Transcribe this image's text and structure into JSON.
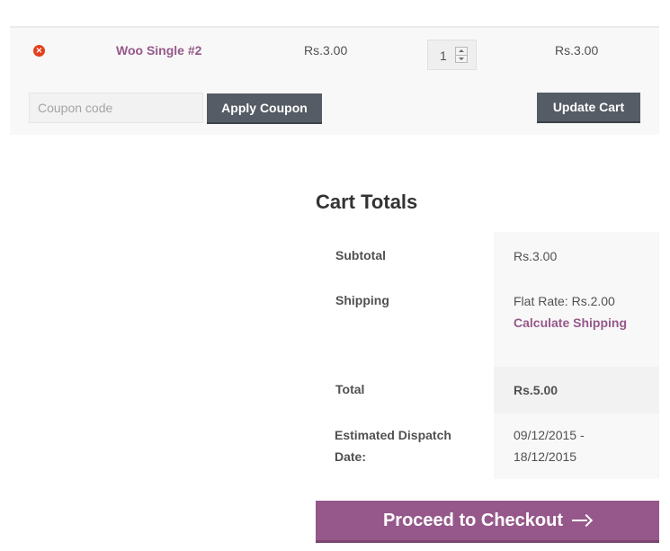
{
  "cart": {
    "items": [
      {
        "remove_symbol": "×",
        "product_name": "Woo Single #2",
        "price": "Rs.3.00",
        "quantity": "1",
        "subtotal": "Rs.3.00"
      }
    ],
    "coupon": {
      "placeholder": "Coupon code",
      "value": "",
      "apply_label": "Apply Coupon"
    },
    "update_label": "Update Cart"
  },
  "totals": {
    "title": "Cart Totals",
    "subtotal_label": "Subtotal",
    "subtotal_value": "Rs.3.00",
    "shipping_label": "Shipping",
    "shipping_value": "Flat Rate: Rs.2.00",
    "calculate_shipping_label": "Calculate Shipping",
    "total_label": "Total",
    "total_value": "Rs.5.00",
    "dispatch_label_line1": "Estimated Dispatch",
    "dispatch_label_line2": "Date:",
    "dispatch_value_line1": "09/12/2015 -",
    "dispatch_value_line2": "18/12/2015"
  },
  "checkout": {
    "label": "Proceed to Checkout",
    "icon": "arrow-right-icon"
  },
  "colors": {
    "accent": "#96588a",
    "dark_button": "#555c65",
    "remove": "#e2401c"
  }
}
